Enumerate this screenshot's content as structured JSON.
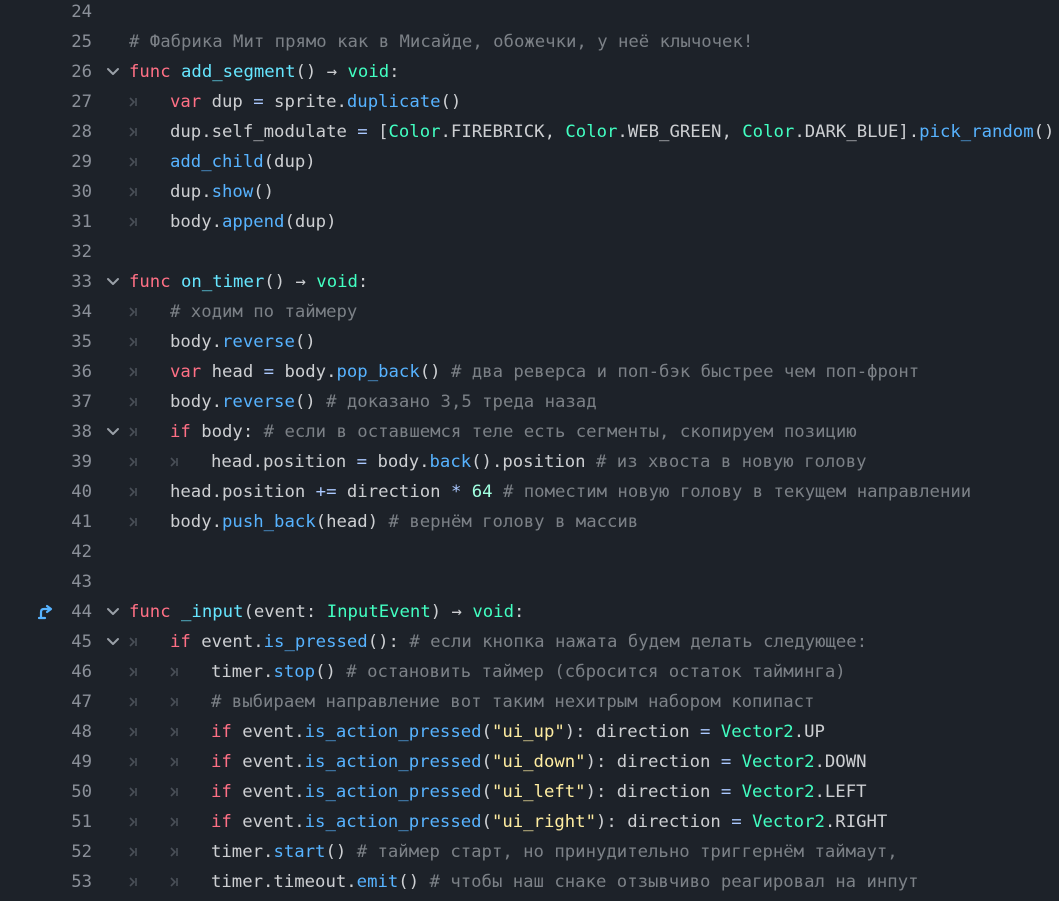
{
  "editor": {
    "colors": {
      "background": "#1d2229",
      "line_number": "#8b9099",
      "keyword": "#ff7085",
      "function_name": "#66e6ff",
      "method_call": "#57b3ff",
      "engine_type": "#42ffc2",
      "string": "#ffeda1",
      "number": "#a1ffe0",
      "comment": "#7c8187",
      "identifier": "#cdcfd2",
      "operator": "#abc9ff"
    },
    "icons": {
      "tab_marker": "tab-indent-icon",
      "fold": "chevron-down-icon",
      "override": "override-arrow-icon"
    },
    "lines": [
      {
        "n": "24",
        "indent": 0,
        "tokens": []
      },
      {
        "n": "25",
        "indent": 0,
        "tokens": [
          {
            "t": "# Фабрика Мит прямо как в Мисайде, обожечки, у неё клычочек!",
            "c": "cm"
          }
        ]
      },
      {
        "n": "26",
        "indent": 0,
        "fold": true,
        "tokens": [
          {
            "t": "func",
            "c": "kw"
          },
          {
            "t": " ",
            "c": "id"
          },
          {
            "t": "add_segment",
            "c": "fn"
          },
          {
            "t": "() → ",
            "c": "id"
          },
          {
            "t": "void",
            "c": "type"
          },
          {
            "t": ":",
            "c": "id"
          }
        ]
      },
      {
        "n": "27",
        "indent": 1,
        "tokens": [
          {
            "t": "var",
            "c": "kw"
          },
          {
            "t": " dup ",
            "c": "id"
          },
          {
            "t": "=",
            "c": "op"
          },
          {
            "t": " sprite.",
            "c": "id"
          },
          {
            "t": "duplicate",
            "c": "mth"
          },
          {
            "t": "()",
            "c": "id"
          }
        ]
      },
      {
        "n": "28",
        "indent": 1,
        "tokens": [
          {
            "t": "dup.self_modulate ",
            "c": "id"
          },
          {
            "t": "=",
            "c": "op"
          },
          {
            "t": " [",
            "c": "id"
          },
          {
            "t": "Color",
            "c": "type"
          },
          {
            "t": ".FIREBRICK, ",
            "c": "id"
          },
          {
            "t": "Color",
            "c": "type"
          },
          {
            "t": ".WEB_GREEN, ",
            "c": "id"
          },
          {
            "t": "Color",
            "c": "type"
          },
          {
            "t": ".DARK_BLUE].",
            "c": "id"
          },
          {
            "t": "pick_random",
            "c": "mth"
          },
          {
            "t": "()",
            "c": "id"
          }
        ]
      },
      {
        "n": "29",
        "indent": 1,
        "tokens": [
          {
            "t": "add_child",
            "c": "mth"
          },
          {
            "t": "(dup)",
            "c": "id"
          }
        ]
      },
      {
        "n": "30",
        "indent": 1,
        "tokens": [
          {
            "t": "dup.",
            "c": "id"
          },
          {
            "t": "show",
            "c": "mth"
          },
          {
            "t": "()",
            "c": "id"
          }
        ]
      },
      {
        "n": "31",
        "indent": 1,
        "tokens": [
          {
            "t": "body.",
            "c": "id"
          },
          {
            "t": "append",
            "c": "mth"
          },
          {
            "t": "(dup)",
            "c": "id"
          }
        ]
      },
      {
        "n": "32",
        "indent": 0,
        "tokens": []
      },
      {
        "n": "33",
        "indent": 0,
        "fold": true,
        "tokens": [
          {
            "t": "func",
            "c": "kw"
          },
          {
            "t": " ",
            "c": "id"
          },
          {
            "t": "on_timer",
            "c": "fn"
          },
          {
            "t": "() → ",
            "c": "id"
          },
          {
            "t": "void",
            "c": "type"
          },
          {
            "t": ":",
            "c": "id"
          }
        ]
      },
      {
        "n": "34",
        "indent": 1,
        "tokens": [
          {
            "t": "# ходим по таймеру",
            "c": "cm"
          }
        ]
      },
      {
        "n": "35",
        "indent": 1,
        "tokens": [
          {
            "t": "body.",
            "c": "id"
          },
          {
            "t": "reverse",
            "c": "mth"
          },
          {
            "t": "()",
            "c": "id"
          }
        ]
      },
      {
        "n": "36",
        "indent": 1,
        "tokens": [
          {
            "t": "var",
            "c": "kw"
          },
          {
            "t": " head ",
            "c": "id"
          },
          {
            "t": "=",
            "c": "op"
          },
          {
            "t": " body.",
            "c": "id"
          },
          {
            "t": "pop_back",
            "c": "mth"
          },
          {
            "t": "() ",
            "c": "id"
          },
          {
            "t": "# два реверса и поп-бэк быстрее чем поп-фронт",
            "c": "cm"
          }
        ]
      },
      {
        "n": "37",
        "indent": 1,
        "tokens": [
          {
            "t": "body.",
            "c": "id"
          },
          {
            "t": "reverse",
            "c": "mth"
          },
          {
            "t": "() ",
            "c": "id"
          },
          {
            "t": "# доказано 3,5 треда назад",
            "c": "cm"
          }
        ]
      },
      {
        "n": "38",
        "indent": 1,
        "fold": true,
        "tokens": [
          {
            "t": "if",
            "c": "kw"
          },
          {
            "t": " body: ",
            "c": "id"
          },
          {
            "t": "# если в оставшемся теле есть сегменты, скопируем позицию",
            "c": "cm"
          }
        ]
      },
      {
        "n": "39",
        "indent": 2,
        "tokens": [
          {
            "t": "head.position ",
            "c": "id"
          },
          {
            "t": "=",
            "c": "op"
          },
          {
            "t": " body.",
            "c": "id"
          },
          {
            "t": "back",
            "c": "mth"
          },
          {
            "t": "().position ",
            "c": "id"
          },
          {
            "t": "# из хвоста в новую голову",
            "c": "cm"
          }
        ]
      },
      {
        "n": "40",
        "indent": 1,
        "tokens": [
          {
            "t": "head.position ",
            "c": "id"
          },
          {
            "t": "+=",
            "c": "op"
          },
          {
            "t": " direction ",
            "c": "id"
          },
          {
            "t": "*",
            "c": "op"
          },
          {
            "t": " ",
            "c": "id"
          },
          {
            "t": "64",
            "c": "num"
          },
          {
            "t": " ",
            "c": "id"
          },
          {
            "t": "# поместим новую голову в текущем направлении",
            "c": "cm"
          }
        ]
      },
      {
        "n": "41",
        "indent": 1,
        "tokens": [
          {
            "t": "body.",
            "c": "id"
          },
          {
            "t": "push_back",
            "c": "mth"
          },
          {
            "t": "(head) ",
            "c": "id"
          },
          {
            "t": "# вернём голову в массив",
            "c": "cm"
          }
        ]
      },
      {
        "n": "42",
        "indent": 0,
        "tokens": []
      },
      {
        "n": "43",
        "indent": 0,
        "tokens": []
      },
      {
        "n": "44",
        "indent": 0,
        "fold": true,
        "override": true,
        "tokens": [
          {
            "t": "func",
            "c": "kw"
          },
          {
            "t": " ",
            "c": "id"
          },
          {
            "t": "_input",
            "c": "fn"
          },
          {
            "t": "(event: ",
            "c": "id"
          },
          {
            "t": "InputEvent",
            "c": "type"
          },
          {
            "t": ") → ",
            "c": "id"
          },
          {
            "t": "void",
            "c": "type"
          },
          {
            "t": ":",
            "c": "id"
          }
        ]
      },
      {
        "n": "45",
        "indent": 1,
        "fold": true,
        "tokens": [
          {
            "t": "if",
            "c": "kw"
          },
          {
            "t": " event.",
            "c": "id"
          },
          {
            "t": "is_pressed",
            "c": "mth"
          },
          {
            "t": "(): ",
            "c": "id"
          },
          {
            "t": "# если кнопка нажата будем делать следующее:",
            "c": "cm"
          }
        ]
      },
      {
        "n": "46",
        "indent": 2,
        "tokens": [
          {
            "t": "timer.",
            "c": "id"
          },
          {
            "t": "stop",
            "c": "mth"
          },
          {
            "t": "() ",
            "c": "id"
          },
          {
            "t": "# остановить таймер (сбросится остаток тайминга)",
            "c": "cm"
          }
        ]
      },
      {
        "n": "47",
        "indent": 2,
        "tokens": [
          {
            "t": "# выбираем направление вот таким нехитрым набором копипаст",
            "c": "cm"
          }
        ]
      },
      {
        "n": "48",
        "indent": 2,
        "tokens": [
          {
            "t": "if",
            "c": "kw"
          },
          {
            "t": " event.",
            "c": "id"
          },
          {
            "t": "is_action_pressed",
            "c": "mth"
          },
          {
            "t": "(",
            "c": "id"
          },
          {
            "t": "\"ui_up\"",
            "c": "str"
          },
          {
            "t": "): direction ",
            "c": "id"
          },
          {
            "t": "=",
            "c": "op"
          },
          {
            "t": " ",
            "c": "id"
          },
          {
            "t": "Vector2",
            "c": "type"
          },
          {
            "t": ".UP",
            "c": "id"
          }
        ]
      },
      {
        "n": "49",
        "indent": 2,
        "tokens": [
          {
            "t": "if",
            "c": "kw"
          },
          {
            "t": " event.",
            "c": "id"
          },
          {
            "t": "is_action_pressed",
            "c": "mth"
          },
          {
            "t": "(",
            "c": "id"
          },
          {
            "t": "\"ui_down\"",
            "c": "str"
          },
          {
            "t": "): direction ",
            "c": "id"
          },
          {
            "t": "=",
            "c": "op"
          },
          {
            "t": " ",
            "c": "id"
          },
          {
            "t": "Vector2",
            "c": "type"
          },
          {
            "t": ".DOWN",
            "c": "id"
          }
        ]
      },
      {
        "n": "50",
        "indent": 2,
        "tokens": [
          {
            "t": "if",
            "c": "kw"
          },
          {
            "t": " event.",
            "c": "id"
          },
          {
            "t": "is_action_pressed",
            "c": "mth"
          },
          {
            "t": "(",
            "c": "id"
          },
          {
            "t": "\"ui_left\"",
            "c": "str"
          },
          {
            "t": "): direction ",
            "c": "id"
          },
          {
            "t": "=",
            "c": "op"
          },
          {
            "t": " ",
            "c": "id"
          },
          {
            "t": "Vector2",
            "c": "type"
          },
          {
            "t": ".LEFT",
            "c": "id"
          }
        ]
      },
      {
        "n": "51",
        "indent": 2,
        "tokens": [
          {
            "t": "if",
            "c": "kw"
          },
          {
            "t": " event.",
            "c": "id"
          },
          {
            "t": "is_action_pressed",
            "c": "mth"
          },
          {
            "t": "(",
            "c": "id"
          },
          {
            "t": "\"ui_right\"",
            "c": "str"
          },
          {
            "t": "): direction ",
            "c": "id"
          },
          {
            "t": "=",
            "c": "op"
          },
          {
            "t": " ",
            "c": "id"
          },
          {
            "t": "Vector2",
            "c": "type"
          },
          {
            "t": ".RIGHT",
            "c": "id"
          }
        ]
      },
      {
        "n": "52",
        "indent": 2,
        "tokens": [
          {
            "t": "timer.",
            "c": "id"
          },
          {
            "t": "start",
            "c": "mth"
          },
          {
            "t": "() ",
            "c": "id"
          },
          {
            "t": "# таймер старт, но принудительно триггернём таймаут,",
            "c": "cm"
          }
        ]
      },
      {
        "n": "53",
        "indent": 2,
        "tokens": [
          {
            "t": "timer.timeout.",
            "c": "id"
          },
          {
            "t": "emit",
            "c": "mth"
          },
          {
            "t": "() ",
            "c": "id"
          },
          {
            "t": "# чтобы наш снаке отзывчиво реагировал на инпут",
            "c": "cm"
          }
        ]
      }
    ]
  }
}
